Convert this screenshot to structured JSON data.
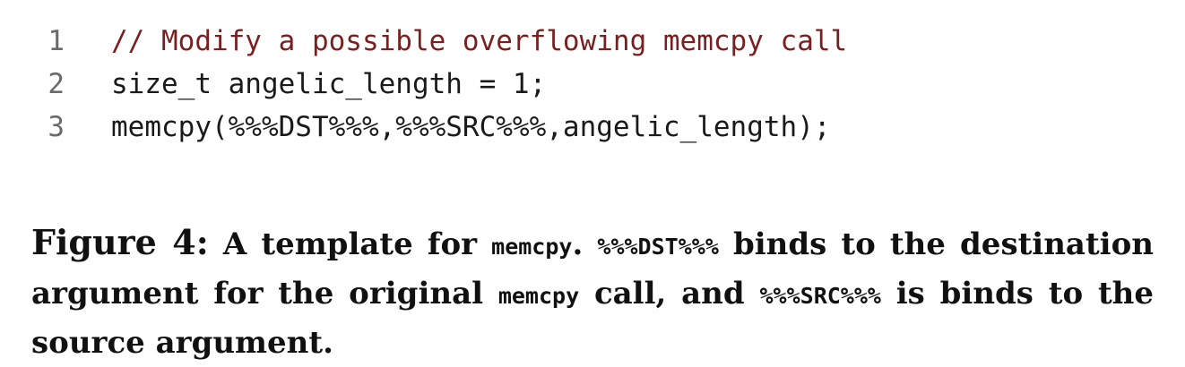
{
  "code": {
    "lines": [
      {
        "number": "1",
        "text": "// Modify a possible overflowing memcpy call"
      },
      {
        "number": "2",
        "text": "size_t angelic_length = 1;"
      },
      {
        "number": "3",
        "text": "memcpy(%%%DST%%%,%%%SRC%%%,angelic_length);"
      }
    ]
  },
  "caption": {
    "label": "Figure 4:",
    "part1": " A template for ",
    "code1": "memcpy",
    "part2": ". ",
    "code2": "%%%DST%%%",
    "part3": " binds to the destination argument for the original ",
    "code3": "memcpy",
    "part4": " call, and ",
    "code4": "%%%SRC%%%",
    "part5": " is binds to the source argument."
  }
}
